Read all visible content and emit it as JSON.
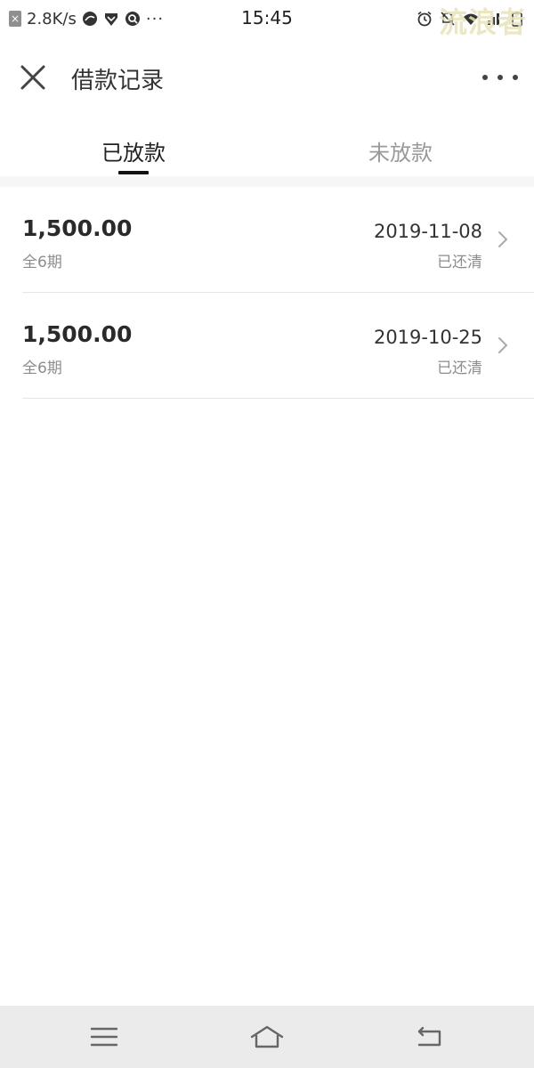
{
  "status_bar": {
    "speed": "2.8K/s",
    "time": "15:45",
    "watermark": "流浪者",
    "dots": "···"
  },
  "header": {
    "title": "借款记录"
  },
  "tabs": [
    {
      "label": "已放款",
      "active": true
    },
    {
      "label": "未放款",
      "active": false
    }
  ],
  "records": [
    {
      "amount": "1,500.00",
      "term": "全6期",
      "date": "2019-11-08",
      "status": "已还清"
    },
    {
      "amount": "1,500.00",
      "term": "全6期",
      "date": "2019-10-25",
      "status": "已还清"
    }
  ],
  "colors": {
    "text_primary": "#222222",
    "text_secondary": "#8d8d8d",
    "tab_inactive": "#999999",
    "nav_background": "#ebebeb"
  },
  "icons": {
    "close": "close-icon",
    "more": "more-dots-icon",
    "chevron": "chevron-right-icon",
    "nav_menu": "menu-icon",
    "nav_home": "home-icon",
    "nav_back": "back-icon"
  }
}
